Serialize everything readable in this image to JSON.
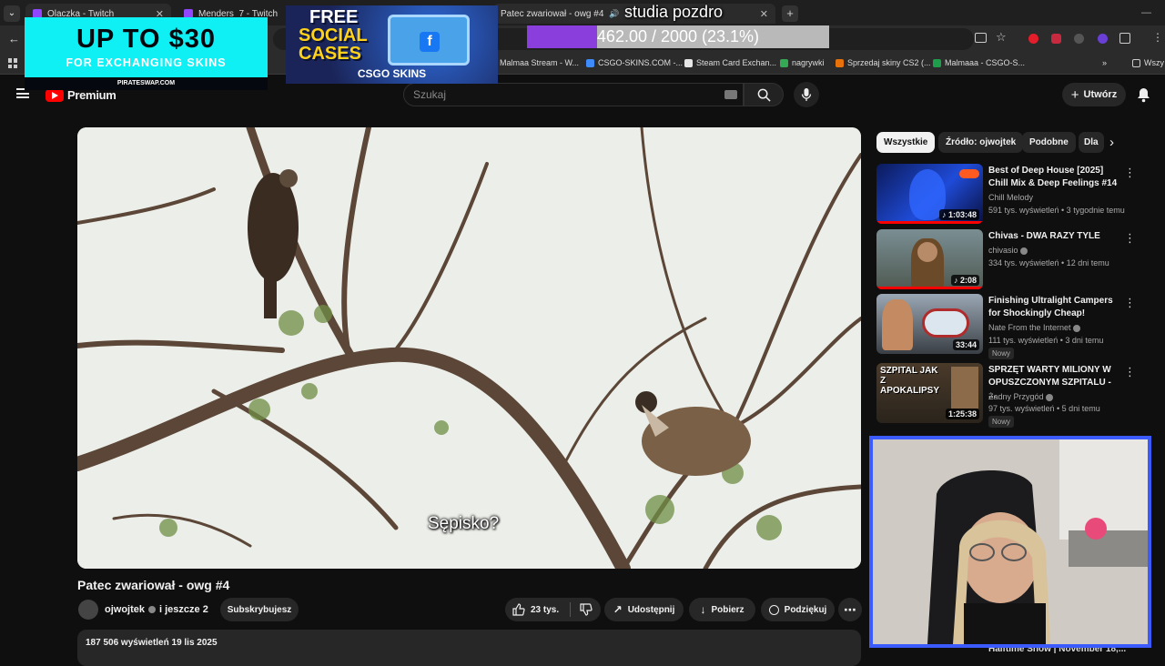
{
  "browser": {
    "tabs": [
      {
        "label": "Olaczka - Twitch",
        "left": 0
      },
      {
        "label": "Menders_7 - Twitch",
        "left": 0
      },
      {
        "label": "Patec zwariował - owg #4",
        "left": 0
      }
    ],
    "bookmarks": [
      "Malmaa Stream - W...",
      "CSGO-SKINS.COM -...",
      "Steam Card Exchan...",
      "nagrywki",
      "Sprzedaj skiny CS2 (...",
      "Malmaaa - CSGO-S...",
      "Wszy"
    ]
  },
  "youtube": {
    "logo_label": "Premium",
    "search_placeholder": "Szukaj",
    "create_label": "Utwórz",
    "video": {
      "subtitle": "Sępisko?",
      "title": "Patec zwariował - owg #4",
      "channel": "ojwojtek",
      "channel_extra": "i jeszcze 2",
      "subscribe_label": "Subskrybujesz",
      "likes": "23 tys.",
      "share_label": "Udostępnij",
      "download_label": "Pobierz",
      "thanks_label": "Podziękuj",
      "views_date": "187 506 wyświetleń  19 lis 2025"
    },
    "chips": [
      "Wszystkie",
      "Źródło: ojwojtek",
      "Podobne",
      "Dla"
    ],
    "recommendations": [
      {
        "title": "Best of Deep House [2025] Chill Mix & Deep Feelings #14",
        "channel": "Chill Melody",
        "meta": "591 tys. wyświetleń • 3 tygodnie temu",
        "duration": "1:03:48",
        "badge": ""
      },
      {
        "title": "Chivas - DWA RAZY TYLE",
        "channel": "chivasio",
        "meta": "334 tys. wyświetleń • 12 dni temu",
        "duration": "2:08",
        "badge": ""
      },
      {
        "title": "Finishing Ultralight Campers for Shockingly Cheap!",
        "channel": "Nate From the Internet",
        "meta": "111 tys. wyświetleń • 3 dni temu",
        "duration": "33:44",
        "badge": "Nowy"
      },
      {
        "title": "SPRZĘT WARTY MILIONY W OPUSZCZONYM SZPITALU - ...",
        "channel": "Żadny Przygód",
        "meta": "97 tys. wyświetleń • 5 dni temu",
        "duration": "1:25:38",
        "badge": "Nowy"
      }
    ],
    "rec_thumb_text": "SZPITAL JAK Z APOKALIPSY",
    "bottom_partial": "Halftime Show | November 18,..."
  },
  "overlays": {
    "ad1_line1": "UP TO $30",
    "ad1_line2": "FOR EXCHANGING SKINS",
    "ad1_site": "PIRATESWAP.COM",
    "ad2_line1": "FREE",
    "ad2_line2": "SOCIAL",
    "ad2_line3": "CASES",
    "ad2_brand": "CSGO SKINS",
    "goal_title": "studia pozdro",
    "goal_text": "462.00 / 2000 (23.1%)",
    "goal_fraction": 0.231
  }
}
